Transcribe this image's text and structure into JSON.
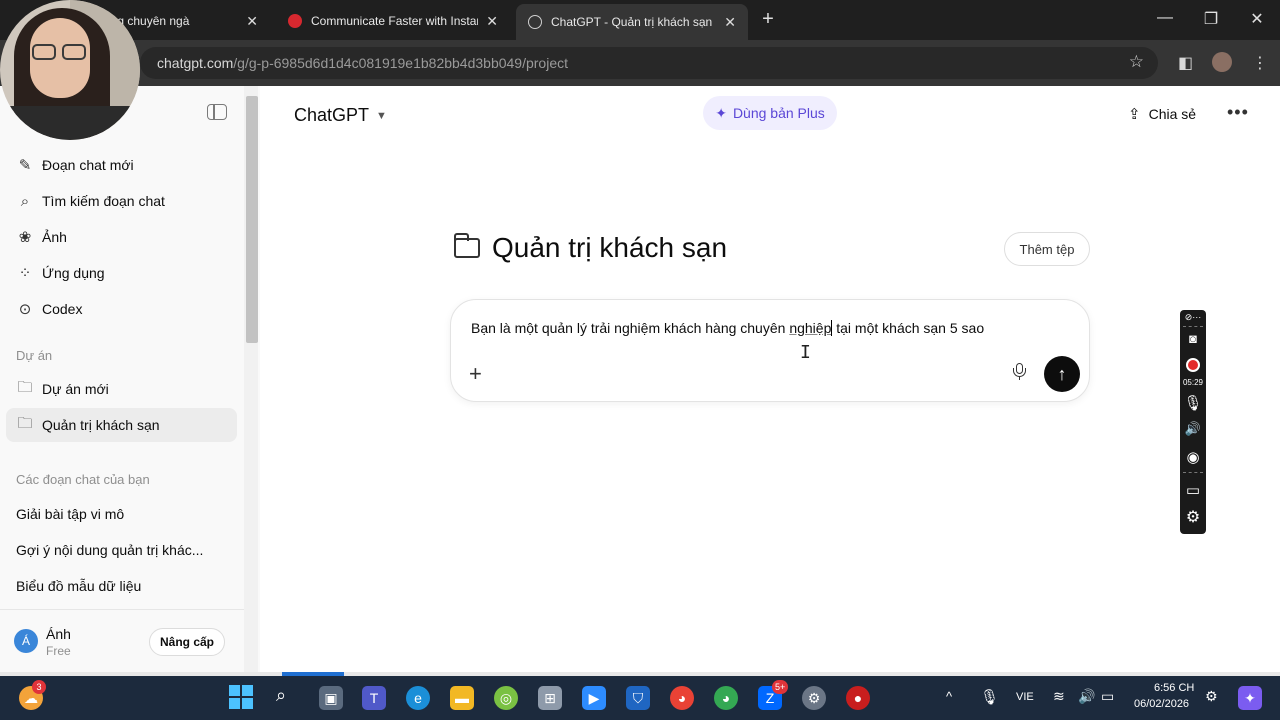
{
  "browser": {
    "tabs": [
      {
        "title": "AI trong chuyên ngà",
        "active": false
      },
      {
        "title": "Communicate Faster with Instan",
        "active": false
      },
      {
        "title": "ChatGPT - Quản trị khách sạn",
        "active": true
      }
    ],
    "url_host": "chatgpt.com",
    "url_path": "/g/g-p-6985d6d1d4c081919e1b82bb4d3bb049/project"
  },
  "sidebar": {
    "items": [
      {
        "label": "Đoạn chat mới",
        "icon": "edit-icon"
      },
      {
        "label": "Tìm kiếm đoạn chat",
        "icon": "search-icon"
      },
      {
        "label": "Ảnh",
        "icon": "image-icon"
      },
      {
        "label": "Ứng dụng",
        "icon": "apps-icon"
      },
      {
        "label": "Codex",
        "icon": "codex-icon"
      }
    ],
    "projects_header": "Dự án",
    "projects": [
      {
        "label": "Dự án mới",
        "icon": "new-folder-icon"
      },
      {
        "label": "Quản trị khách sạn",
        "icon": "folder-icon",
        "active": true
      }
    ],
    "chats_header": "Các đoạn chat của bạn",
    "chats": [
      "Giải bài tập vi mô",
      "Gợi ý nội dung quản trị khác...",
      "Biểu đồ mẫu dữ liệu"
    ],
    "user": {
      "initial": "Á",
      "name": "Ánh",
      "plan": "Free",
      "upgrade_label": "Nâng cấp"
    }
  },
  "header": {
    "model": "ChatGPT",
    "plus_label": "Dùng bản Plus",
    "share_label": "Chia sẻ"
  },
  "project": {
    "title": "Quản trị khách sạn",
    "add_file_label": "Thêm tệp"
  },
  "composer": {
    "text_before": "Bạn là một quản lý trải nghiệm khách hàng chuyên ",
    "text_underlined": "nghiệp",
    "text_after": " tại một khách sạn 5 sao"
  },
  "recorder": {
    "time": "05:29"
  },
  "taskbar": {
    "weather_badge": "3",
    "zalo_badge": "5+",
    "lang": "VIE",
    "time": "6:56 CH",
    "date": "06/02/2026"
  },
  "colors": {
    "accent_plus": "#5b47d6",
    "send": "#0d0d0d",
    "record": "#e32b2b"
  }
}
